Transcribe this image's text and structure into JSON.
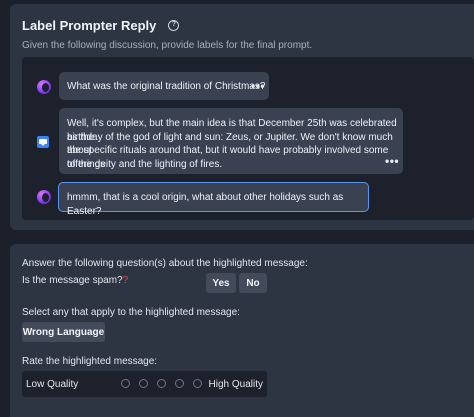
{
  "header": {
    "title": "Label Prompter Reply",
    "subtitle": "Given the following discussion, provide labels for the final prompt."
  },
  "messages": [
    {
      "role": "assistant",
      "text": "What was the original tradition of Christmas?"
    },
    {
      "role": "user",
      "lines": [
        "Well, it's complex, but the main idea is that December 25th was celebrated as the",
        "birthday of the god of light and sun:  Zeus, or Jupiter.  We don't know much about",
        "the specific rituals around that, but it would have probably involved some offerings",
        "to the deity and the lighting of fires."
      ]
    },
    {
      "role": "assistant",
      "text": "hmmm, that is a cool origin, what about other holidays such as Easter?",
      "highlighted": true
    }
  ],
  "more_glyph": "•••",
  "labels_section": {
    "intro": "Answer the following question(s) about the highlighted message:",
    "spam_question": "Is the message spam?",
    "required_mark": "?",
    "yes_label": "Yes",
    "no_label": "No",
    "select_prompt": "Select any that apply to the highlighted message:",
    "wrong_language_label": "Wrong Language",
    "rate_prompt": "Rate the highlighted message:",
    "low_label": "Low Quality",
    "high_label": "High Quality"
  },
  "colors": {
    "background": "#1b202b",
    "card": "#2d3442",
    "bubble": "#3a4252",
    "highlight_border": "#5b93f0",
    "assistant_avatar": "#8b3df0",
    "user_avatar": "#3b82f6"
  },
  "icons": [
    "help-circle-icon",
    "assistant-avatar-icon",
    "user-avatar-icon",
    "more-options-icon"
  ]
}
